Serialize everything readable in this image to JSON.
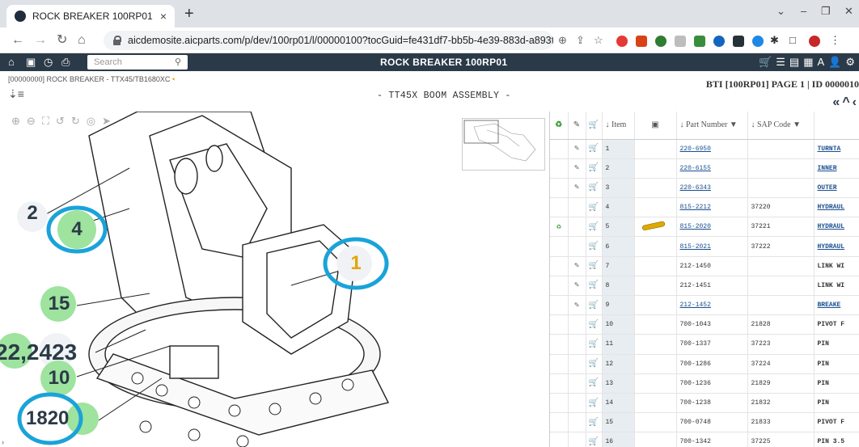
{
  "browser": {
    "tab_title": "ROCK BREAKER 100RP01",
    "tab_close": "×",
    "new_tab": "+",
    "url": "aicdemosite.aicparts.com/p/dev/100rp01/l/00000100?tocGuid=fe431df7-bb5b-4e39-883d-a893f..."
  },
  "app": {
    "search_placeholder": "Search",
    "title": "ROCK BREAKER 100RP01",
    "breadcrumb": "[00000000] ROCK BREAKER - TTX45/TB1680XC",
    "assembly_title": "- TT45X BOOM ASSEMBLY -",
    "page_info": "BTI [100RP01]  PAGE 1 | ID 0000010"
  },
  "viewer": {
    "callouts": [
      "2",
      "4",
      "1",
      "15",
      "22,2423",
      "10",
      "1820"
    ]
  },
  "table": {
    "headers": {
      "item": "↓ Item",
      "part_number": "↓ Part Number",
      "sap_code": "↓ SAP Code"
    },
    "rows": [
      {
        "item": "1",
        "part": "220-6950",
        "sap": "",
        "desc": "TURNTA",
        "pen": true,
        "recycle": false,
        "img": false,
        "link": true
      },
      {
        "item": "2",
        "part": "220-6155",
        "sap": "",
        "desc": "INNER",
        "pen": true,
        "recycle": false,
        "img": false,
        "link": true
      },
      {
        "item": "3",
        "part": "220-6343",
        "sap": "",
        "desc": "OUTER",
        "pen": true,
        "recycle": false,
        "img": false,
        "link": true
      },
      {
        "item": "4",
        "part": "815-2212",
        "sap": "37220",
        "desc": "HYDRAUL",
        "pen": false,
        "recycle": false,
        "img": false,
        "link": true
      },
      {
        "item": "5",
        "part": "815-2020",
        "sap": "37221",
        "desc": "HYDRAUL",
        "pen": false,
        "recycle": true,
        "img": true,
        "link": true
      },
      {
        "item": "6",
        "part": "815-2021",
        "sap": "37222",
        "desc": "HYDRAUL",
        "pen": false,
        "recycle": false,
        "img": false,
        "link": true
      },
      {
        "item": "7",
        "part": "212-1450",
        "sap": "",
        "desc": "LINK WI",
        "pen": true,
        "recycle": false,
        "img": false,
        "link": false
      },
      {
        "item": "8",
        "part": "212-1451",
        "sap": "",
        "desc": "LINK WI",
        "pen": true,
        "recycle": false,
        "img": false,
        "link": false
      },
      {
        "item": "9",
        "part": "212-1452",
        "sap": "",
        "desc": "BREAKE",
        "pen": true,
        "recycle": false,
        "img": false,
        "link": true
      },
      {
        "item": "10",
        "part": "700-1043",
        "sap": "21828",
        "desc": "PIVOT F",
        "pen": false,
        "recycle": false,
        "img": false,
        "link": false
      },
      {
        "item": "11",
        "part": "700-1337",
        "sap": "37223",
        "desc": "PIN",
        "pen": false,
        "recycle": false,
        "img": false,
        "link": false
      },
      {
        "item": "12",
        "part": "700-1286",
        "sap": "37224",
        "desc": "PIN",
        "pen": false,
        "recycle": false,
        "img": false,
        "link": false
      },
      {
        "item": "13",
        "part": "700-1236",
        "sap": "21829",
        "desc": "PIN",
        "pen": false,
        "recycle": false,
        "img": false,
        "link": false
      },
      {
        "item": "14",
        "part": "700-1238",
        "sap": "21832",
        "desc": "PIN",
        "pen": false,
        "recycle": false,
        "img": false,
        "link": false
      },
      {
        "item": "15",
        "part": "700-0748",
        "sap": "21833",
        "desc": "PIVOT F",
        "pen": false,
        "recycle": false,
        "img": false,
        "link": false
      },
      {
        "item": "16",
        "part": "700-1342",
        "sap": "37225",
        "desc": "PIN 3.5",
        "pen": false,
        "recycle": false,
        "img": false,
        "link": false
      }
    ]
  },
  "colors": {
    "toolbar": "#2b3a48",
    "callout_green": "#9ee39e",
    "highlight_ring": "#1aa3d9",
    "gold": "#e2a600"
  }
}
